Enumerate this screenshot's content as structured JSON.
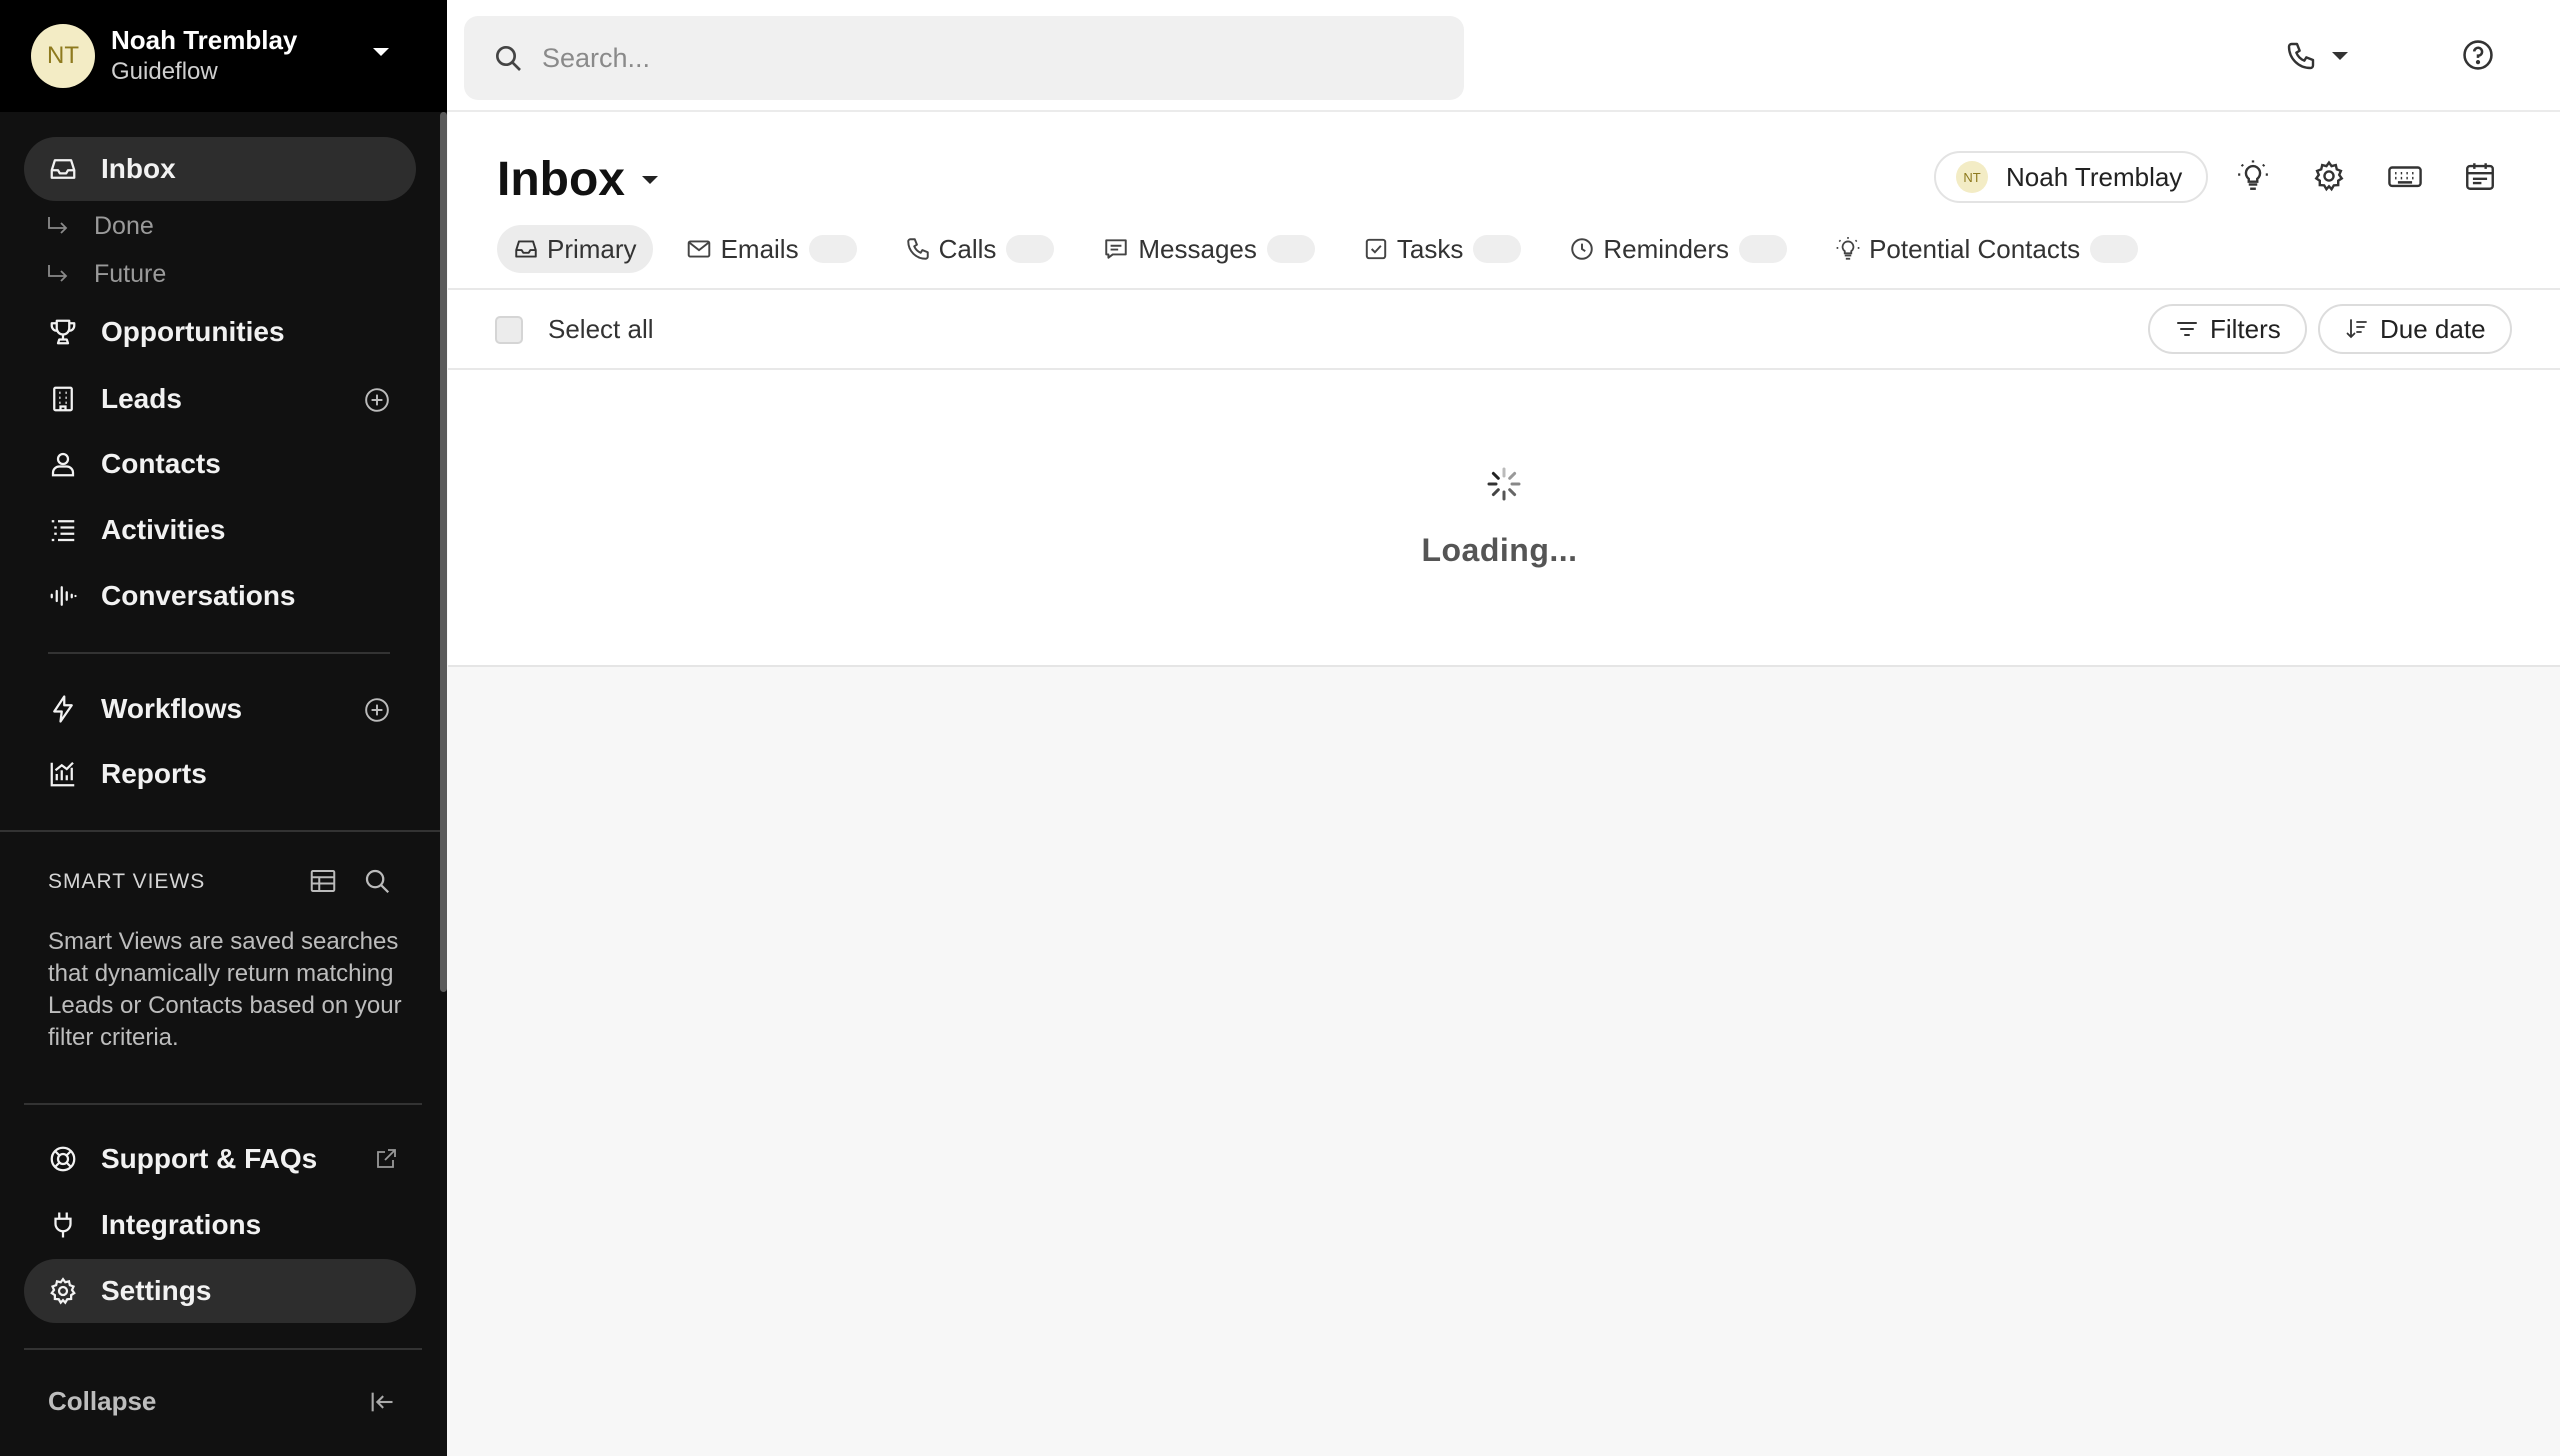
{
  "account": {
    "initials": "NT",
    "name": "Noah Tremblay",
    "org": "Guideflow"
  },
  "search": {
    "placeholder": "Search..."
  },
  "sidebar": {
    "inbox": "Inbox",
    "sub_done": "Done",
    "sub_future": "Future",
    "opportunities": "Opportunities",
    "leads": "Leads",
    "contacts": "Contacts",
    "activities": "Activities",
    "conversations": "Conversations",
    "workflows": "Workflows",
    "reports": "Reports",
    "smart_views_title": "SMART VIEWS",
    "smart_views_desc": "Smart Views are saved searches that dynamically return matching Leads or Contacts based on your filter criteria.",
    "support": "Support & FAQs",
    "integrations": "Integrations",
    "settings": "Settings",
    "collapse": "Collapse"
  },
  "header": {
    "title": "Inbox",
    "user_initials": "NT",
    "user_name": "Noah Tremblay"
  },
  "tabs": {
    "primary": "Primary",
    "emails": "Emails",
    "calls": "Calls",
    "messages": "Messages",
    "tasks": "Tasks",
    "reminders": "Reminders",
    "potential_contacts": "Potential Contacts"
  },
  "toolbar": {
    "select_all": "Select all",
    "filters": "Filters",
    "sort": "Due date"
  },
  "content": {
    "loading": "Loading..."
  },
  "colors": {
    "sidebar_bg": "#111111",
    "account_bg": "#000000",
    "avatar_bg": "#f3ecc5"
  }
}
